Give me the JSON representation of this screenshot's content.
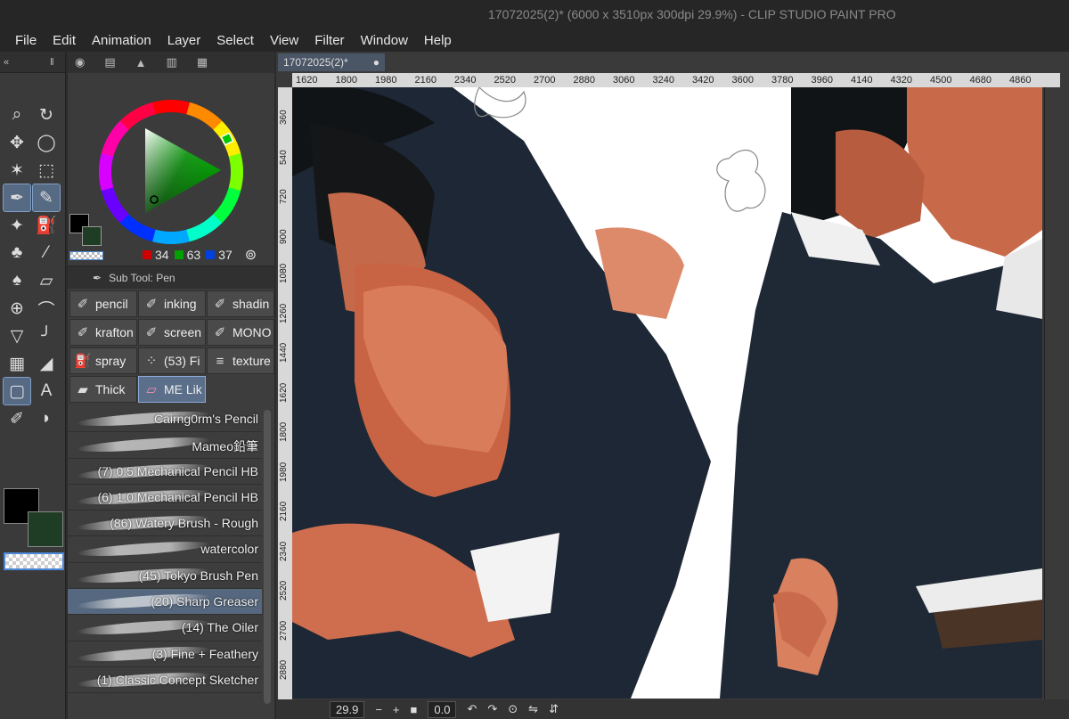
{
  "window": {
    "title": "17072025(2)* (6000 x 3510px 300dpi 29.9%)  - CLIP STUDIO PAINT PRO"
  },
  "menu": [
    "File",
    "Edit",
    "Animation",
    "Layer",
    "Select",
    "View",
    "Filter",
    "Window",
    "Help"
  ],
  "color_panel": {
    "r": "34",
    "g": "63",
    "b": "37",
    "fg_color": "#000000",
    "bg_color": "#1f3d24"
  },
  "sub_tool": {
    "title": "Sub Tool: Pen",
    "tools": [
      {
        "label": "pencil",
        "icon": "pencil-icon"
      },
      {
        "label": "inking",
        "icon": "pen-icon"
      },
      {
        "label": "shadin",
        "icon": "pen-icon"
      },
      {
        "label": "krafton",
        "icon": "pen-icon"
      },
      {
        "label": "screen",
        "icon": "pen-icon"
      },
      {
        "label": "MONO",
        "icon": "pen-icon"
      },
      {
        "label": "spray",
        "icon": "spray-icon"
      },
      {
        "label": "(53) Fi",
        "icon": "dots-icon"
      },
      {
        "label": "texture",
        "icon": "lines-icon"
      },
      {
        "label": "Thick",
        "icon": "marker-icon"
      },
      {
        "label": "ME Lik",
        "icon": "eraser-icon"
      }
    ],
    "brushes": [
      "Cairng0rm's Pencil",
      "Mameo鉛筆",
      "(7) 0.5 Mechanical Pencil HB",
      "(6) 1.0 Mechanical Pencil HB",
      "(86) Watery Brush - Rough",
      "watercolor",
      "(45) Tokyo Brush Pen",
      "(20) Sharp Greaser",
      "(14) The Oiler",
      "(3) Fine + Feathery",
      "(1) Classic Concept Sketcher"
    ]
  },
  "canvas": {
    "tab": "17072025(2)*",
    "ruler_h": [
      "1620",
      "1800",
      "1980",
      "2160",
      "2340",
      "2520",
      "2700",
      "2880",
      "3060",
      "3240",
      "3420",
      "3600",
      "3780",
      "3960",
      "4140",
      "4320",
      "4500",
      "4680",
      "4860"
    ],
    "ruler_v": [
      "360",
      "540",
      "720",
      "900",
      "1080",
      "1260",
      "1440",
      "1620",
      "1800",
      "1980",
      "2160",
      "2340",
      "2520",
      "2700",
      "2880"
    ],
    "zoom": "29.9",
    "rotation": "0.0"
  }
}
